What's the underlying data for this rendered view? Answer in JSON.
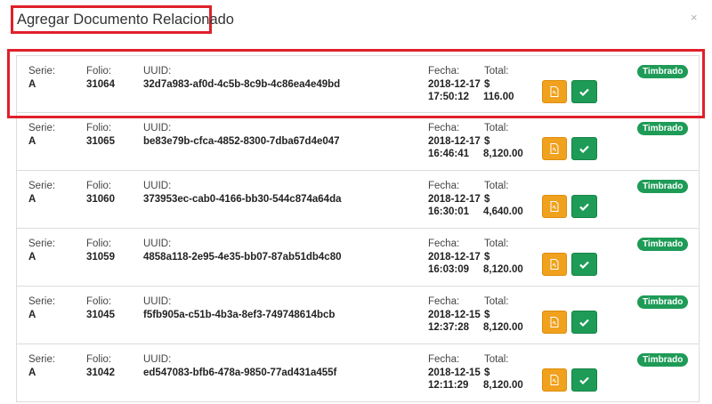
{
  "modal": {
    "title": "Agregar Documento Relacionado",
    "close": "×"
  },
  "labels": {
    "serie": "Serie:",
    "folio": "Folio:",
    "uuid": "UUID:",
    "fecha": "Fecha:",
    "total": "Total:",
    "currency": "$"
  },
  "icons": {
    "pdf": "file-pdf-icon",
    "check": "check-icon"
  },
  "colors": {
    "highlight": "#e0202a",
    "pdf_button": "#f0a11d",
    "confirm_button": "#1e9b57",
    "badge": "#1e9b57"
  },
  "documents": [
    {
      "serie": "A",
      "folio": "31064",
      "uuid": "32d7a983-af0d-4c5b-8c9b-4c86ea4e49bd",
      "date": "2018-12-17",
      "time": "17:50:12",
      "total": "116.00",
      "status": "Timbrado"
    },
    {
      "serie": "A",
      "folio": "31065",
      "uuid": "be83e79b-cfca-4852-8300-7dba67d4e047",
      "date": "2018-12-17",
      "time": "16:46:41",
      "total": "8,120.00",
      "status": "Timbrado"
    },
    {
      "serie": "A",
      "folio": "31060",
      "uuid": "373953ec-cab0-4166-bb30-544c874a64da",
      "date": "2018-12-17",
      "time": "16:30:01",
      "total": "4,640.00",
      "status": "Timbrado"
    },
    {
      "serie": "A",
      "folio": "31059",
      "uuid": "4858a118-2e95-4e35-bb07-87ab51db4c80",
      "date": "2018-12-17",
      "time": "16:03:09",
      "total": "8,120.00",
      "status": "Timbrado"
    },
    {
      "serie": "A",
      "folio": "31045",
      "uuid": "f5fb905a-c51b-4b3a-8ef3-749748614bcb",
      "date": "2018-12-15",
      "time": "12:37:28",
      "total": "8,120.00",
      "status": "Timbrado"
    },
    {
      "serie": "A",
      "folio": "31042",
      "uuid": "ed547083-bfb6-478a-9850-77ad431a455f",
      "date": "2018-12-15",
      "time": "12:11:29",
      "total": "8,120.00",
      "status": "Timbrado"
    }
  ]
}
